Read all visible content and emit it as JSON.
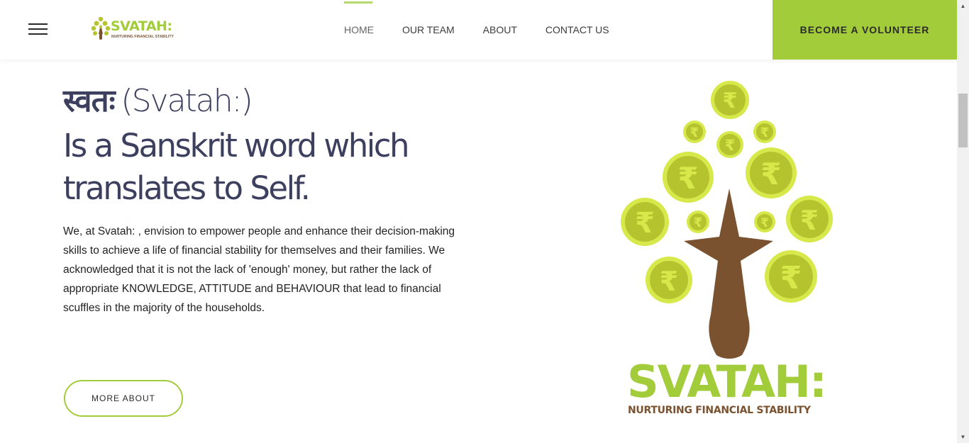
{
  "header": {
    "logo": {
      "word": "SVATAH:",
      "tagline": "NURTURING FINANCIAL STABILITY"
    },
    "nav": [
      {
        "label": "HOME",
        "active": true
      },
      {
        "label": "OUR TEAM",
        "active": false
      },
      {
        "label": "ABOUT",
        "active": false
      },
      {
        "label": "CONTACT US",
        "active": false
      }
    ],
    "cta_label": "BECOME A VOLUNTEER"
  },
  "hero": {
    "title_devanagari": "स्वतः",
    "title_latin": "(Svatah:)",
    "subtitle_line1": "Is a Sanskrit word which",
    "subtitle_line2": "translates to Self.",
    "body": "We, at Svatah: , envision to empower people and enhance their decision-making skills to achieve a life of financial stability for themselves and their families. We acknowledged that it is not the lack of 'enough' money, but rather the lack of appropriate KNOWLEDGE, ATTITUDE and BEHAVIOUR that lead to financial scuffles in the majority of the households.",
    "button_label": "MORE ABOUT"
  },
  "illustration": {
    "coin_symbol": "₹",
    "brand_word": "SVATAH:",
    "brand_tagline": "NURTURING FINANCIAL STABILITY"
  },
  "colors": {
    "accent_green": "#a2cc3a",
    "coin_fill": "#b5c42e",
    "coin_ring": "#d7e84a",
    "trunk_brown": "#7a5230",
    "heading_navy": "#3d3f5e",
    "active_nav_line": "#b5d96a"
  },
  "icons": {
    "menu": "hamburger-icon",
    "scroll_up": "triangle-up-icon",
    "scroll_down": "triangle-down-icon"
  }
}
